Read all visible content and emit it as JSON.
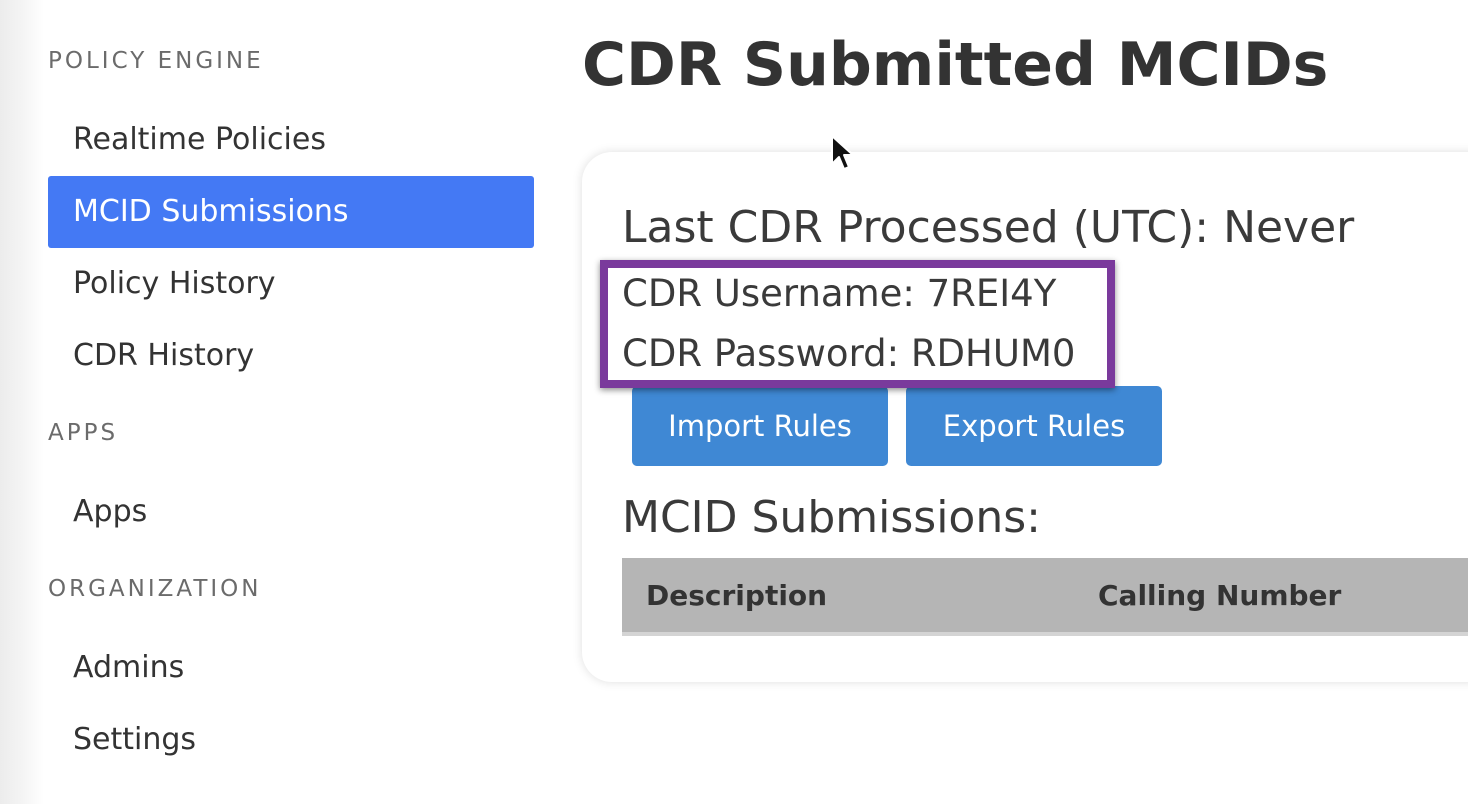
{
  "sidebar": {
    "sections": [
      {
        "title": "POLICY ENGINE",
        "items": [
          {
            "label": "Realtime Policies"
          },
          {
            "label": "MCID Submissions"
          },
          {
            "label": "Policy History"
          },
          {
            "label": "CDR History"
          }
        ]
      },
      {
        "title": "APPS",
        "items": [
          {
            "label": "Apps"
          }
        ]
      },
      {
        "title": "ORGANIZATION",
        "items": [
          {
            "label": "Admins"
          },
          {
            "label": "Settings"
          }
        ]
      }
    ],
    "active_item": "MCID Submissions"
  },
  "main": {
    "title": "CDR Submitted MCIDs",
    "last_cdr": "Last CDR Processed (UTC): Never",
    "cdr_username": "CDR Username: 7REI4Y",
    "cdr_password": "CDR Password: RDHUM0",
    "buttons": {
      "import": "Import Rules",
      "export": "Export Rules"
    },
    "submissions_heading": "MCID Submissions:",
    "table": {
      "columns": [
        "Description",
        "Calling Number"
      ]
    }
  },
  "colors": {
    "active_nav": "#4479f4",
    "button": "#3f88d4",
    "highlight": "#7a3a9c",
    "table_header": "#b5b5b5"
  },
  "icons": {
    "cursor": "mouse-pointer-icon"
  }
}
